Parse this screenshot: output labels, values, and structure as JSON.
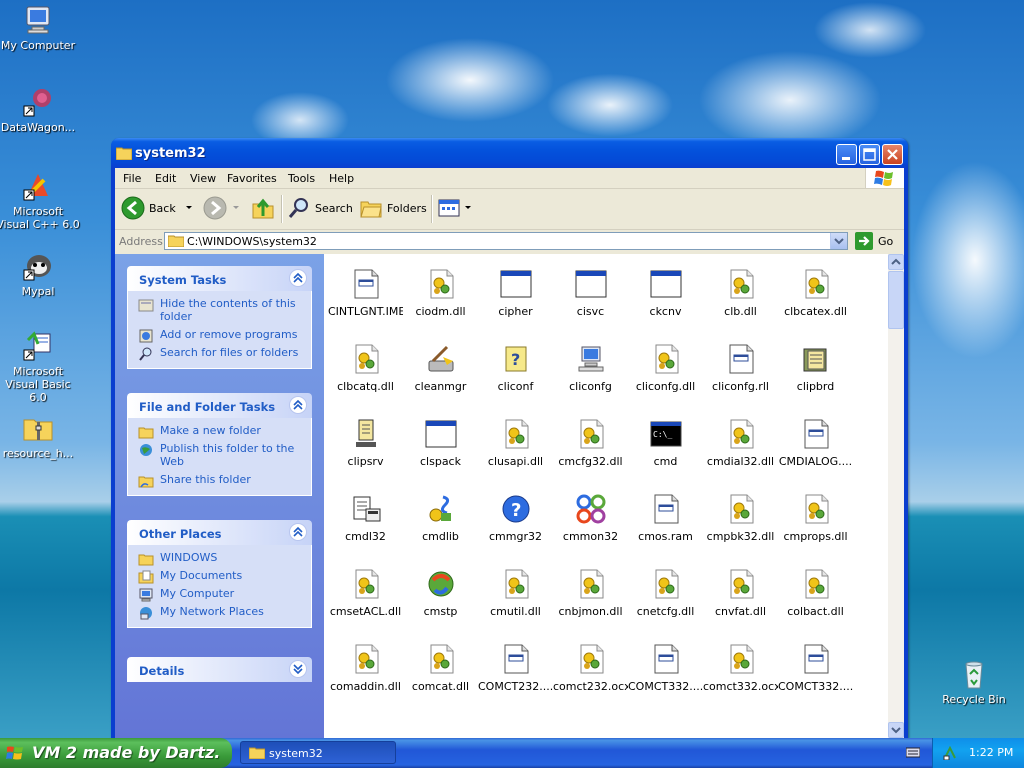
{
  "desktop": {
    "icons": [
      {
        "label": "My Computer"
      },
      {
        "label": "DataWagon..."
      },
      {
        "label": "Microsoft Visual C++ 6.0"
      },
      {
        "label": "Mypal"
      },
      {
        "label": "Microsoft Visual Basic 6.0"
      },
      {
        "label": "resource_h..."
      },
      {
        "label": "Recycle Bin"
      }
    ]
  },
  "window": {
    "title": "system32",
    "menu": [
      "File",
      "Edit",
      "View",
      "Favorites",
      "Tools",
      "Help"
    ],
    "toolbar": {
      "back": "Back",
      "search": "Search",
      "folders": "Folders"
    },
    "address": {
      "label": "Address",
      "value": "C:\\WINDOWS\\system32",
      "go": "Go"
    }
  },
  "tasks": {
    "system": {
      "title": "System Tasks",
      "items": [
        "Hide the contents of this folder",
        "Add or remove programs",
        "Search for files or folders"
      ]
    },
    "file_folder": {
      "title": "File and Folder Tasks",
      "items": [
        "Make a new folder",
        "Publish this folder to the Web",
        "Share this folder"
      ]
    },
    "other_places": {
      "title": "Other Places",
      "items": [
        "WINDOWS",
        "My Documents",
        "My Computer",
        "My Network Places"
      ]
    },
    "details": {
      "title": "Details"
    }
  },
  "files": [
    {
      "name": "CINTLGNT.IME",
      "icon": "file-ime"
    },
    {
      "name": "ciodm.dll",
      "icon": "dll"
    },
    {
      "name": "cipher",
      "icon": "console-window"
    },
    {
      "name": "cisvc",
      "icon": "console-window"
    },
    {
      "name": "ckcnv",
      "icon": "console-window"
    },
    {
      "name": "clb.dll",
      "icon": "dll"
    },
    {
      "name": "clbcatex.dll",
      "icon": "dll"
    },
    {
      "name": "clbcatq.dll",
      "icon": "dll"
    },
    {
      "name": "cleanmgr",
      "icon": "disk-cleanup"
    },
    {
      "name": "cliconf",
      "icon": "help-file"
    },
    {
      "name": "cliconfg",
      "icon": "computer"
    },
    {
      "name": "cliconfg.dll",
      "icon": "dll"
    },
    {
      "name": "cliconfg.rll",
      "icon": "file-ime"
    },
    {
      "name": "clipbrd",
      "icon": "clipbook"
    },
    {
      "name": "clipsrv",
      "icon": "clipsrv"
    },
    {
      "name": "clspack",
      "icon": "console-window"
    },
    {
      "name": "clusapi.dll",
      "icon": "dll"
    },
    {
      "name": "cmcfg32.dll",
      "icon": "dll"
    },
    {
      "name": "cmd",
      "icon": "cmd"
    },
    {
      "name": "cmdial32.dll",
      "icon": "dll"
    },
    {
      "name": "CMDIALOG....",
      "icon": "file-ime"
    },
    {
      "name": "cmdl32",
      "icon": "phone"
    },
    {
      "name": "cmdlib",
      "icon": "cmdlib"
    },
    {
      "name": "cmmgr32",
      "icon": "help-circle"
    },
    {
      "name": "cmmon32",
      "icon": "cmmon"
    },
    {
      "name": "cmos.ram",
      "icon": "file-ime"
    },
    {
      "name": "cmpbk32.dll",
      "icon": "dll"
    },
    {
      "name": "cmprops.dll",
      "icon": "dll"
    },
    {
      "name": "cmsetACL.dll",
      "icon": "dll"
    },
    {
      "name": "cmstp",
      "icon": "cmstp"
    },
    {
      "name": "cmutil.dll",
      "icon": "dll"
    },
    {
      "name": "cnbjmon.dll",
      "icon": "dll"
    },
    {
      "name": "cnetcfg.dll",
      "icon": "dll"
    },
    {
      "name": "cnvfat.dll",
      "icon": "dll"
    },
    {
      "name": "colbact.dll",
      "icon": "dll"
    },
    {
      "name": "comaddin.dll",
      "icon": "dll"
    },
    {
      "name": "comcat.dll",
      "icon": "dll"
    },
    {
      "name": "COMCT232....",
      "icon": "file-ime"
    },
    {
      "name": "comct232.ocx",
      "icon": "dll"
    },
    {
      "name": "COMCT332....",
      "icon": "file-ime"
    },
    {
      "name": "comct332.ocx",
      "icon": "dll"
    },
    {
      "name": "COMCT332....",
      "icon": "file-ime"
    }
  ],
  "taskbar": {
    "start_label": "VM 2 made by Dartz.",
    "task_button": "system32",
    "clock": "1:22 PM"
  },
  "colors": {
    "titlebar": "#0452dc",
    "task_pane_link": "#215dc6",
    "start_green": "#3a9b3a"
  }
}
